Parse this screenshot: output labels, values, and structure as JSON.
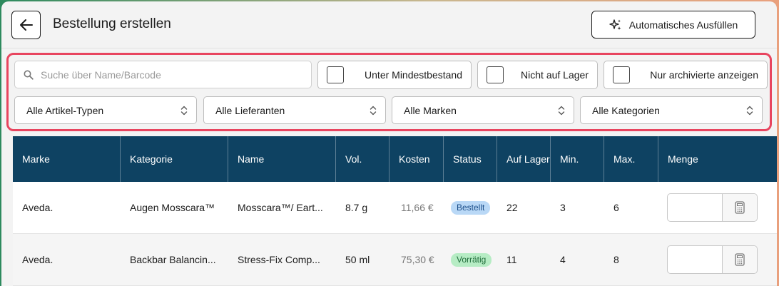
{
  "header": {
    "title": "Bestellung erstellen",
    "autofill_label": "Automatisches Ausfüllen",
    "back_icon": "arrow-left-icon",
    "autofill_icon": "sparkle-icon"
  },
  "filters": {
    "search_placeholder": "Suche über Name/Barcode",
    "search_value": "",
    "checkboxes": [
      {
        "label": "Unter Mindestbestand",
        "checked": false
      },
      {
        "label": "Nicht auf Lager",
        "checked": false
      },
      {
        "label": "Nur archivierte anzeigen",
        "checked": false
      }
    ],
    "selects": [
      {
        "value": "Alle Artikel-Typen"
      },
      {
        "value": "Alle Lieferanten"
      },
      {
        "value": "Alle Marken"
      },
      {
        "value": "Alle Kategorien"
      }
    ],
    "highlight_color": "#e8455f"
  },
  "table": {
    "header_color": "#0e4262",
    "columns": [
      "Marke",
      "Kategorie",
      "Name",
      "Vol.",
      "Kosten",
      "Status",
      "Auf Lager",
      "Min.",
      "Max.",
      "Menge"
    ],
    "rows": [
      {
        "brand": "Aveda.",
        "category": "Augen Mosscara™",
        "name": "Mosscara™/ Eart...",
        "vol": "8.7 g",
        "cost": "11,66 €",
        "status": "Bestellt",
        "status_color": "#b9d8f6",
        "stock": "22",
        "min": "3",
        "max": "6",
        "qty": ""
      },
      {
        "brand": "Aveda.",
        "category": "Backbar Balancin...",
        "name": "Stress-Fix Comp...",
        "vol": "50 ml",
        "cost": "75,30 €",
        "status": "Vorrätig",
        "status_color": "#b6ecc4",
        "stock": "11",
        "min": "4",
        "max": "8",
        "qty": ""
      }
    ]
  }
}
